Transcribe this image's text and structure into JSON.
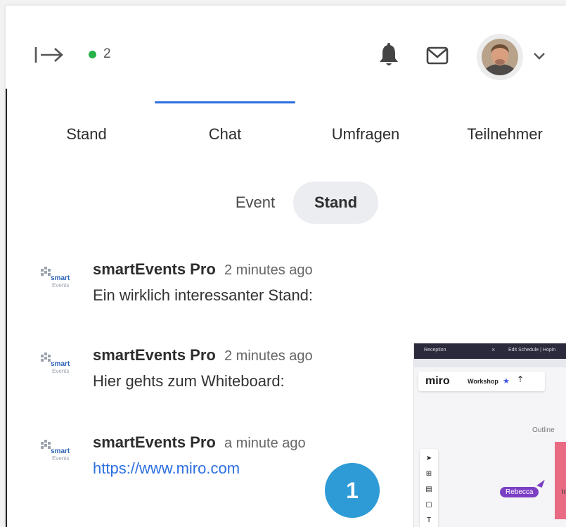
{
  "header": {
    "online_count": "2",
    "colors": {
      "online": "#27b24a",
      "accent": "#2c6fe0"
    },
    "icons": [
      "collapse-arrow-icon",
      "bell-icon",
      "mail-icon",
      "chevron-down-icon"
    ]
  },
  "tabs": [
    {
      "label": "Stand"
    },
    {
      "label": "Chat",
      "active": true
    },
    {
      "label": "Umfragen"
    },
    {
      "label": "Teilnehmer"
    }
  ],
  "segments": {
    "event": "Event",
    "stand": "Stand",
    "selected": "Stand"
  },
  "messages": [
    {
      "author": "smartEvents Pro",
      "time": "2 minutes ago",
      "text": "Ein wirklich interessanter Stand:"
    },
    {
      "author": "smartEvents Pro",
      "time": "2 minutes ago",
      "text": "Hier gehts zum Whiteboard:"
    },
    {
      "author": "smartEvents Pro",
      "time": "a minute ago",
      "link": "https://www.miro.com"
    }
  ],
  "logo_text": {
    "line1": "smart",
    "line2": "Events"
  },
  "badge": "1",
  "preview": {
    "tab1": "Reception",
    "tab2": "Edit Schedule | Hopin",
    "brand": "miro",
    "board": "Workshop",
    "outline": "Outline",
    "cursor_name": "Rebecca",
    "sticky_text": "In"
  }
}
